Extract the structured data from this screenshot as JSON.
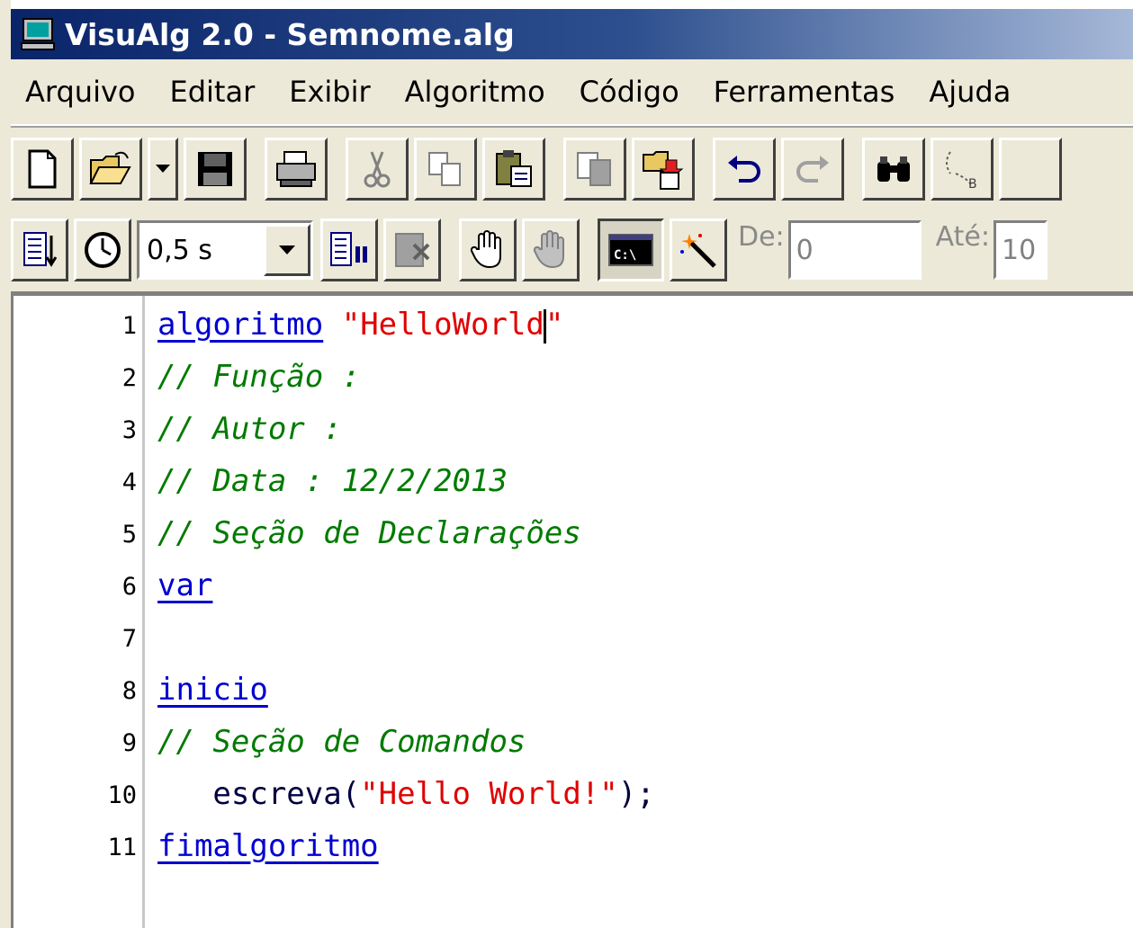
{
  "window": {
    "title": "VisuAlg 2.0 - Semnome.alg",
    "icon": "monitor-icon"
  },
  "menu": [
    "Arquivo",
    "Editar",
    "Exibir",
    "Algoritmo",
    "Código",
    "Ferramentas",
    "Ajuda"
  ],
  "toolbar2": {
    "speed_value": "0,5 s",
    "from_label": "De:",
    "from_value": "0",
    "to_label": "Até:",
    "to_value": "10"
  },
  "editor": {
    "line_numbers": [
      "1",
      "2",
      "3",
      "4",
      "5",
      "6",
      "7",
      "8",
      "9",
      "10",
      "11"
    ],
    "lines": {
      "l1_kw": "algoritmo",
      "l1_str_a": "\"HelloWorld",
      "l1_str_b": "\"",
      "l2": "// Função :",
      "l3": "// Autor :",
      "l4": "// Data : 12/2/2013",
      "l5": "// Seção de Declarações",
      "l6": "var",
      "l8": "inicio",
      "l9": "// Seção de Comandos",
      "l10_a": "   escreva(",
      "l10_str": "\"Hello World!\"",
      "l10_b": ");",
      "l11": "fimalgoritmo"
    }
  },
  "colors": {
    "keyword": "#0000d0",
    "string": "#e00000",
    "comment": "#007a00",
    "titlebar": "#0a246a"
  }
}
